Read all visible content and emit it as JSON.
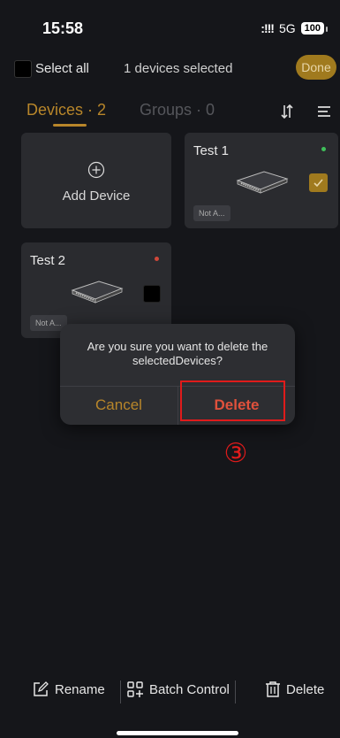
{
  "status_bar": {
    "time": "15:58",
    "signal": ":!!!",
    "network": "5G",
    "battery": "100"
  },
  "selection_bar": {
    "select_all_label": "Select all",
    "selected_count_text": "1 devices selected",
    "done_label": "Done"
  },
  "tabs": [
    {
      "label": "Devices · 2",
      "active": true
    },
    {
      "label": "Groups · 0",
      "active": false
    }
  ],
  "add_device": {
    "label": "Add Device"
  },
  "devices": [
    {
      "name": "Test 1",
      "status_color": "#3fbf5a",
      "badge": "Not A...",
      "selected": true
    },
    {
      "name": "Test 2",
      "status_color": "#d0483a",
      "badge": "Not A...",
      "selected": false
    }
  ],
  "dialog": {
    "message": "Are you sure you want to delete the selectedDevices?",
    "cancel_label": "Cancel",
    "delete_label": "Delete"
  },
  "annotation": {
    "step_marker": "③"
  },
  "bottom_bar": {
    "rename_label": "Rename",
    "batch_control_label": "Batch Control",
    "delete_label": "Delete"
  },
  "colors": {
    "accent": "#b8862a",
    "danger": "#e0513c",
    "highlight": "#e01b1b"
  }
}
